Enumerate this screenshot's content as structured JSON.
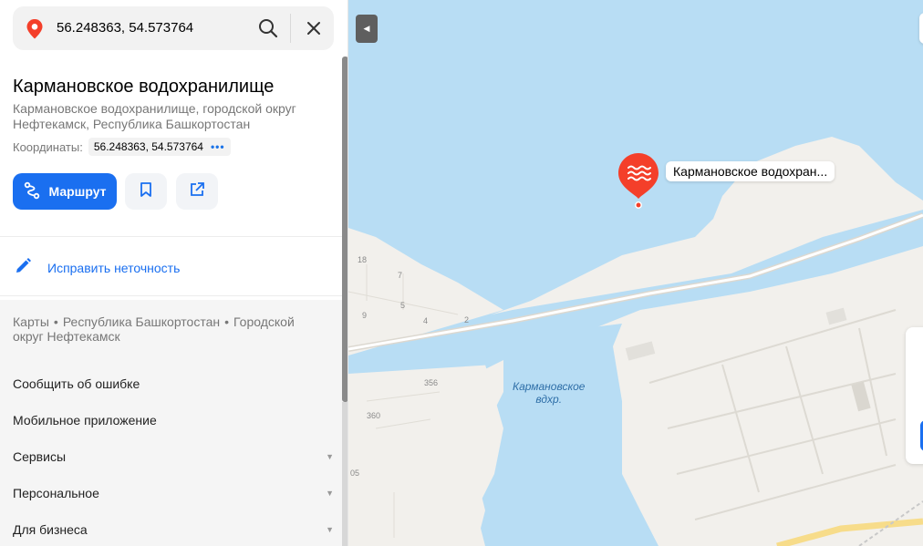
{
  "search": {
    "query": "56.248363, 54.573764",
    "pin_icon": "location-pin-icon",
    "search_icon": "search-icon",
    "close_icon": "close-icon"
  },
  "place": {
    "title": "Кармановское водохранилище",
    "address": "Кармановское водохранилище, городской округ Нефтекамск, Республика Башкортостан",
    "coords_label": "Координаты:",
    "coords_value": "56.248363, 54.573764",
    "coords_more": "•••"
  },
  "actions": {
    "route_label": "Маршрут",
    "bookmark_icon": "bookmark-icon",
    "share_icon": "share-icon"
  },
  "fix": {
    "label": "Исправить неточность",
    "icon": "pencil-icon"
  },
  "breadcrumb": {
    "items": [
      "Карты",
      "Республика Башкортостан",
      "Городской округ Нефтекамск"
    ]
  },
  "menu": {
    "items": [
      {
        "label": "Сообщить об ошибке",
        "caret": ""
      },
      {
        "label": "Мобильное приложение",
        "caret": ""
      },
      {
        "label": "Сервисы",
        "caret": "▼"
      },
      {
        "label": "Персональное",
        "caret": "▼"
      },
      {
        "label": "Для бизнеса",
        "caret": "▼"
      }
    ]
  },
  "map": {
    "collapse_icon": "◀",
    "marker_label": "Кармановское водохран...",
    "water_label_line1": "Кармановское",
    "water_label_line2": "вдхр.",
    "house_numbers": [
      "18",
      "7",
      "5",
      "9",
      "4",
      "2",
      "356",
      "360",
      "05"
    ],
    "colors": {
      "water": "#b8ddf4",
      "land": "#f2f0ec",
      "marker": "#f43f2a",
      "accent": "#1a6ff0"
    }
  }
}
